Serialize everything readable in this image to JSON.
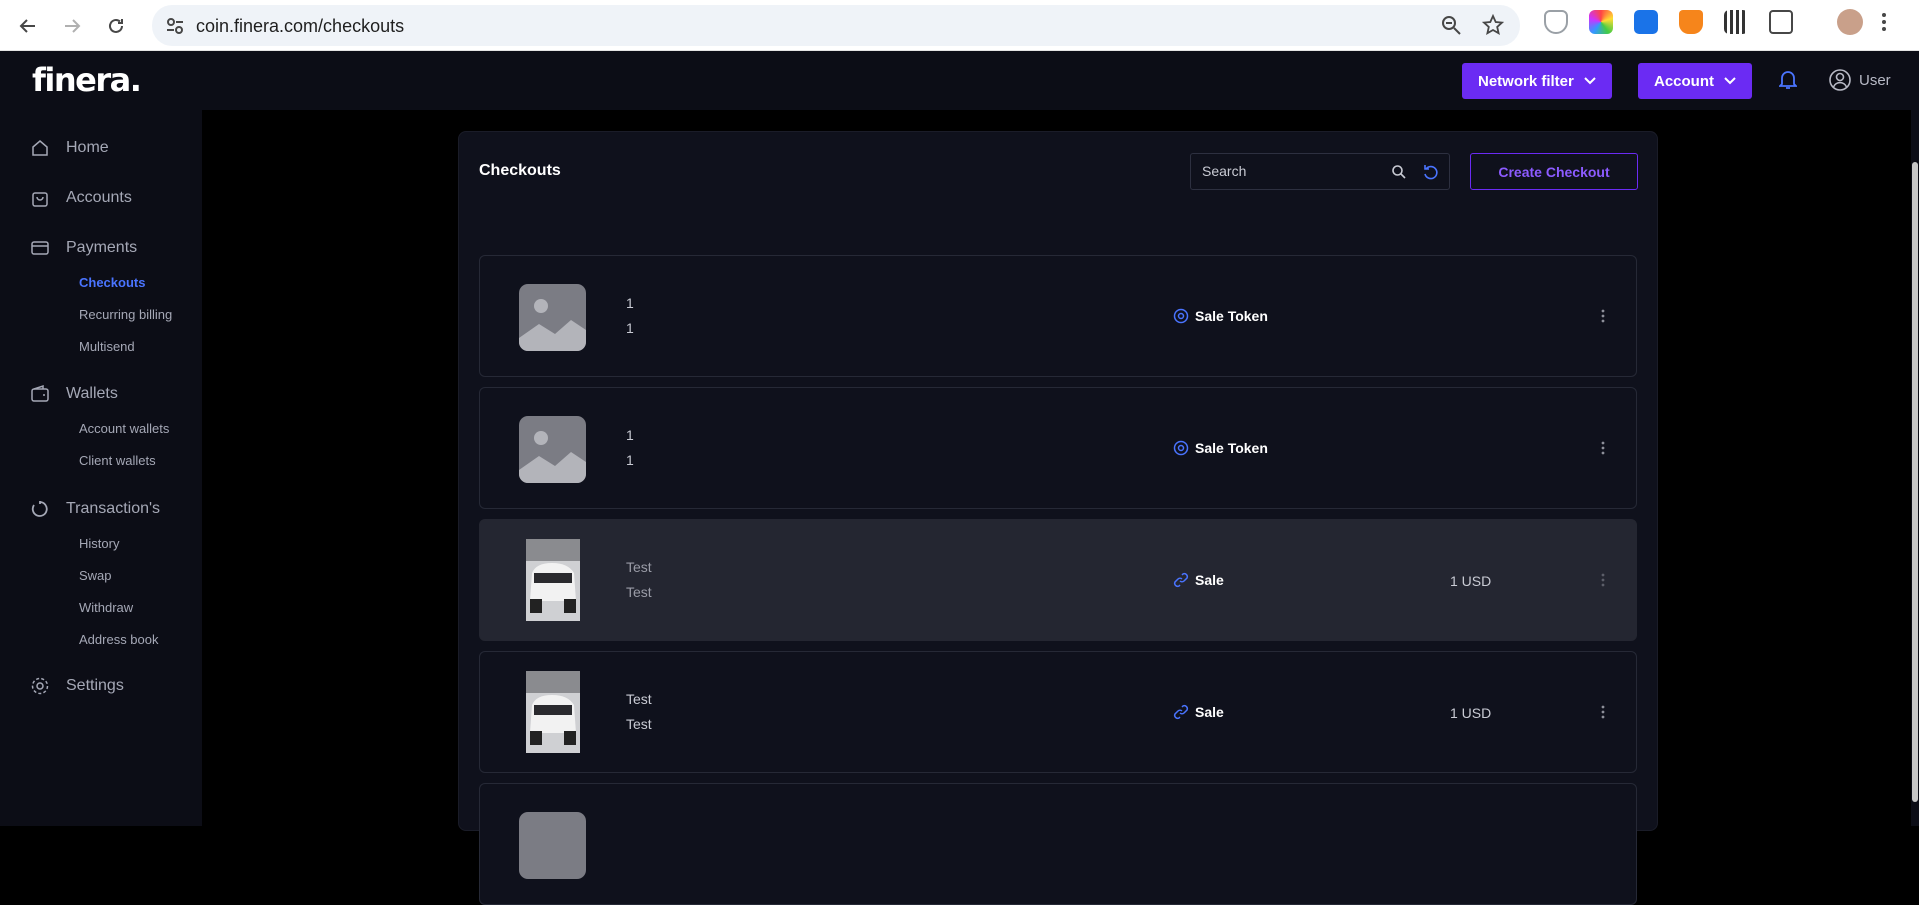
{
  "browser": {
    "url": "coin.finera.com/checkouts"
  },
  "header": {
    "logo": "finera.",
    "network_filter": "Network filter",
    "account": "Account",
    "user": "User"
  },
  "sidebar": {
    "home": "Home",
    "accounts": "Accounts",
    "payments": "Payments",
    "checkouts": "Checkouts",
    "recurring_billing": "Recurring billing",
    "multisend": "Multisend",
    "wallets": "Wallets",
    "account_wallets": "Account wallets",
    "client_wallets": "Client wallets",
    "transactions": "Transaction's",
    "history": "History",
    "swap": "Swap",
    "withdraw": "Withdraw",
    "address_book": "Address book",
    "settings": "Settings"
  },
  "main": {
    "title": "Checkouts",
    "search_placeholder": "Search",
    "create_button": "Create Checkout",
    "checkouts": [
      {
        "line1": "1",
        "line2": "1",
        "type": "Sale Token",
        "price": "",
        "image": "placeholder"
      },
      {
        "line1": "1",
        "line2": "1",
        "type": "Sale Token",
        "price": "",
        "image": "placeholder"
      },
      {
        "line1": "Test",
        "line2": "Test",
        "type": "Sale",
        "price": "1 USD",
        "image": "car-photo"
      },
      {
        "line1": "Test",
        "line2": "Test",
        "type": "Sale",
        "price": "1 USD",
        "image": "car-photo"
      }
    ]
  },
  "colors": {
    "accent": "#6b2bf3",
    "active_link": "#4a74ff",
    "sidebar_bg": "#0c0d16",
    "panel_bg": "#0f111c"
  }
}
